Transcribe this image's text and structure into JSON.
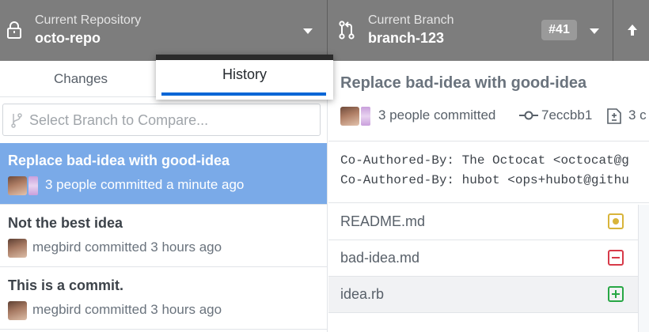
{
  "toolbar": {
    "repository": {
      "label": "Current Repository",
      "value": "octo-repo",
      "icon": "repo-lock-icon"
    },
    "branch": {
      "label": "Current Branch",
      "value": "branch-123",
      "pr_badge": "#41",
      "icon": "git-pull-request-icon"
    },
    "push_icon": "arrow-up-icon"
  },
  "sidebar": {
    "tabs": [
      {
        "label": "Changes",
        "selected": false
      },
      {
        "label": "History",
        "selected": true
      }
    ],
    "branch_filter": {
      "placeholder": "Select Branch to Compare...",
      "icon": "git-branch-icon"
    },
    "commits": [
      {
        "summary": "Replace bad-idea with good-idea",
        "meta": "3 people committed a minute ago",
        "selected": true,
        "avatars": "multiple"
      },
      {
        "summary": "Not the best idea",
        "meta": "megbird committed 3 hours ago",
        "selected": false,
        "avatars": "single"
      },
      {
        "summary": "This is a commit.",
        "meta": "megbird committed 3 hours ago",
        "selected": false,
        "avatars": "single"
      }
    ]
  },
  "detail": {
    "summary": "Replace bad-idea with good-idea",
    "people": "3 people committed",
    "sha": "7eccbb1",
    "files_count_visible": "3 c",
    "body_lines": [
      "Co-Authored-By: The Octocat <octocat@g",
      "Co-Authored-By: hubot <ops+hubot@githu"
    ],
    "files": [
      {
        "name": "README.md",
        "status": "modified",
        "status_color": "#d8b43a"
      },
      {
        "name": "bad-idea.md",
        "status": "deleted",
        "status_color": "#d73a49"
      },
      {
        "name": "idea.rb",
        "status": "added",
        "status_color": "#28a745",
        "selected": true
      }
    ]
  },
  "colors": {
    "toolbar_bg": "#7d7d7d",
    "selected_commit_bg": "#7aaae8",
    "tab_underline": "#0366d6"
  }
}
